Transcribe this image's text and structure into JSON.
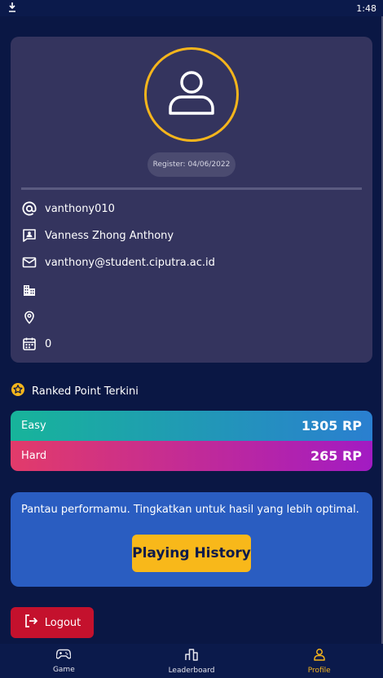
{
  "status_bar": {
    "time": "1:48",
    "download_icon": "download-icon"
  },
  "profile": {
    "avatar_icon": "person-icon",
    "register_label": "Register: 04/06/2022",
    "username": "vanthony010",
    "full_name": "Vanness Zhong Anthony",
    "email": "vanthony@student.ciputra.ac.id",
    "company": "",
    "location": "",
    "calendar_value": "0"
  },
  "ranked": {
    "title": "Ranked Point Terkini",
    "easy_label": "Easy",
    "easy_value": "1305 RP",
    "hard_label": "Hard",
    "hard_value": "265 RP"
  },
  "history": {
    "text": "Pantau performamu. Tingkatkan untuk hasil yang lebih optimal.",
    "button_label": "Playing History"
  },
  "logout": {
    "label": "Logout"
  },
  "nav": {
    "game": "Game",
    "leaderboard": "Leaderboard",
    "profile": "Profile"
  },
  "colors": {
    "background": "#0a1744",
    "card": "#34345e",
    "accent": "#f5b51c",
    "history_card": "#2a5dc1",
    "logout": "#c4112d"
  }
}
